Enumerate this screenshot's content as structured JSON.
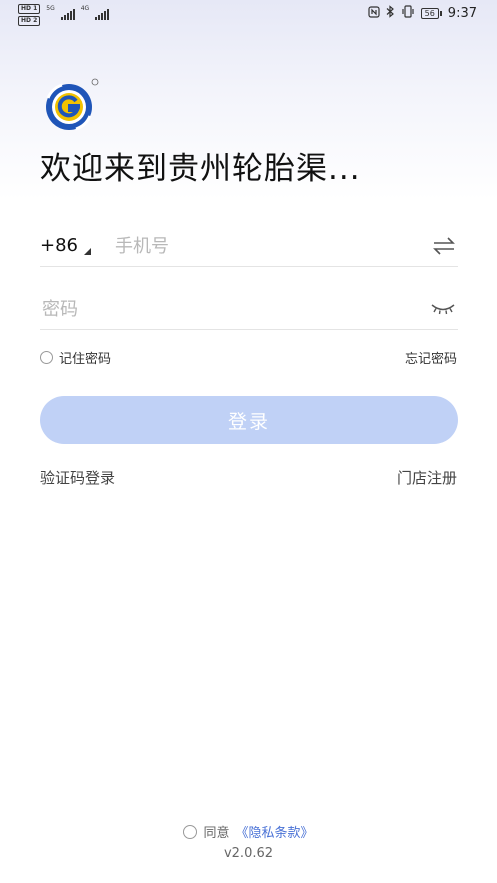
{
  "status_bar": {
    "left_badge_1": "HD 1",
    "left_badge_2": "HD 2",
    "net_1": "5G",
    "net_2": "4G",
    "battery": "56",
    "time": "9:37",
    "icons": [
      "nfc-icon",
      "bluetooth-icon",
      "vibrate-icon",
      "battery-icon"
    ]
  },
  "header": {
    "logo_icon": "app-logo-icon",
    "welcome": "欢迎来到贵州轮胎渠..."
  },
  "login_form": {
    "country_code": "+86",
    "phone_placeholder": "手机号",
    "phone_value": "",
    "password_placeholder": "密码",
    "password_value": "",
    "remember_label": "记住密码",
    "forgot_label": "忘记密码",
    "login_button": "登录",
    "sms_login": "验证码登录",
    "store_register": "门店注册",
    "swap_icon": "swap-arrows-icon",
    "eye_icon": "eye-closed-icon"
  },
  "footer": {
    "agree_label": "同意",
    "privacy_link": "《隐私条款》",
    "version": "v2.0.62"
  },
  "colors": {
    "login_button_bg": "#c0d1f6",
    "link": "#4a72d6",
    "logo_blue": "#1f55b8",
    "logo_yellow": "#f2c200"
  }
}
